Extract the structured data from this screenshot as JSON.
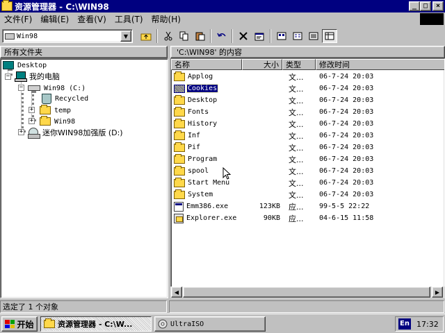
{
  "window": {
    "title": "资源管理器 - C:\\WIN98",
    "controls": [
      "_",
      "□",
      "×"
    ]
  },
  "menu": [
    "文件(F)",
    "编辑(E)",
    "查看(V)",
    "工具(T)",
    "帮助(H)"
  ],
  "address": {
    "value": "Win98"
  },
  "panes": {
    "left_header": "所有文件夹",
    "right_header": "'C:\\WIN98' 的内容"
  },
  "tree": [
    {
      "label": "Desktop",
      "icon": "desktop-icon"
    },
    {
      "label": "我的电脑",
      "icon": "computer-icon"
    },
    {
      "label": "Win98 (C:)",
      "icon": "drive-icon"
    },
    {
      "label": "Recycled",
      "icon": "recycle-bin-icon"
    },
    {
      "label": "temp",
      "icon": "folder-icon"
    },
    {
      "label": "Win98",
      "icon": "folder-icon"
    },
    {
      "label": "迷你WIN98加强版 (D:)",
      "icon": "cd-drive-icon"
    }
  ],
  "columns": [
    "名称",
    "大小",
    "类型",
    "修改时间"
  ],
  "files": [
    {
      "name": "Applog",
      "size": "",
      "type": "文...",
      "modified": "06-7-24 20:03",
      "icon": "folder-icon"
    },
    {
      "name": "Cookies",
      "size": "",
      "type": "文...",
      "modified": "06-7-24 20:03",
      "icon": "folder-icon"
    },
    {
      "name": "Desktop",
      "size": "",
      "type": "文...",
      "modified": "06-7-24 20:03",
      "icon": "folder-icon"
    },
    {
      "name": "Fonts",
      "size": "",
      "type": "文...",
      "modified": "06-7-24 20:03",
      "icon": "folder-icon"
    },
    {
      "name": "History",
      "size": "",
      "type": "文...",
      "modified": "06-7-24 20:03",
      "icon": "folder-icon"
    },
    {
      "name": "Inf",
      "size": "",
      "type": "文...",
      "modified": "06-7-24 20:03",
      "icon": "folder-icon"
    },
    {
      "name": "Pif",
      "size": "",
      "type": "文...",
      "modified": "06-7-24 20:03",
      "icon": "folder-icon"
    },
    {
      "name": "Program",
      "size": "",
      "type": "文...",
      "modified": "06-7-24 20:03",
      "icon": "folder-icon"
    },
    {
      "name": "spool",
      "size": "",
      "type": "文...",
      "modified": "06-7-24 20:03",
      "icon": "folder-icon"
    },
    {
      "name": "Start Menu",
      "size": "",
      "type": "文...",
      "modified": "06-7-24 20:03",
      "icon": "folder-icon"
    },
    {
      "name": "System",
      "size": "",
      "type": "文...",
      "modified": "06-7-24 20:03",
      "icon": "folder-icon"
    },
    {
      "name": "Emm386.exe",
      "size": "123KB",
      "type": "应...",
      "modified": "99-5-5 22:22",
      "icon": "program-icon"
    },
    {
      "name": "Explorer.exe",
      "size": "90KB",
      "type": "应...",
      "modified": "04-6-15 11:58",
      "icon": "explorer-icon"
    }
  ],
  "status": {
    "selection": "选定了 1 个对象",
    "extra": ""
  },
  "taskbar": {
    "start": "开始",
    "tasks": [
      "资源管理器 - C:\\W...",
      "UltraISO"
    ],
    "lang": "En",
    "clock": "17:32"
  }
}
